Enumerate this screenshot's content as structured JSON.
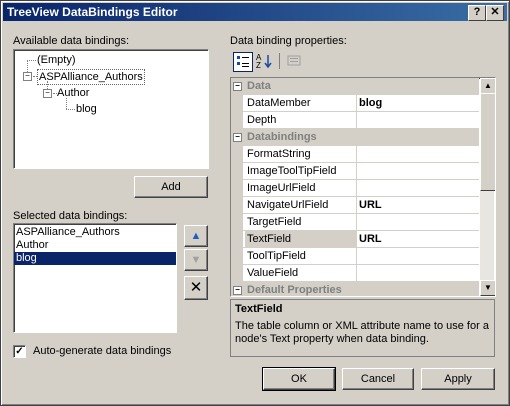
{
  "window": {
    "title": "TreeView DataBindings Editor",
    "help_glyph": "?",
    "close_glyph": "✕"
  },
  "available": {
    "label": "Available data bindings:",
    "items": [
      "(Empty)",
      "ASPAlliance_Authors",
      "Author",
      "blog"
    ],
    "expanded_glyph": "−"
  },
  "add_button": "Add",
  "selected": {
    "label": "Selected data bindings:",
    "items": [
      "ASPAlliance_Authors",
      "Author",
      "blog"
    ],
    "selected_index": 2
  },
  "move_up_glyph": "▲",
  "move_down_glyph": "▼",
  "delete_glyph": "✕",
  "properties": {
    "label": "Data binding properties:",
    "toolbar": {
      "categorized_icon": "categorized-icon",
      "alphabetical_icon": "alphabetical-icon",
      "pages_icon": "property-pages-icon"
    },
    "rows": [
      {
        "type": "cat",
        "name": "Data"
      },
      {
        "type": "prop",
        "name": "DataMember",
        "value": "blog"
      },
      {
        "type": "prop",
        "name": "Depth",
        "value": ""
      },
      {
        "type": "cat",
        "name": "Databindings"
      },
      {
        "type": "prop",
        "name": "FormatString",
        "value": ""
      },
      {
        "type": "prop",
        "name": "ImageToolTipField",
        "value": ""
      },
      {
        "type": "prop",
        "name": "ImageUrlField",
        "value": ""
      },
      {
        "type": "prop",
        "name": "NavigateUrlField",
        "value": "URL"
      },
      {
        "type": "prop",
        "name": "TargetField",
        "value": ""
      },
      {
        "type": "prop",
        "name": "TextField",
        "value": "URL",
        "active": true
      },
      {
        "type": "prop",
        "name": "ToolTipField",
        "value": ""
      },
      {
        "type": "prop",
        "name": "ValueField",
        "value": ""
      },
      {
        "type": "cat",
        "name": "Default Properties"
      }
    ],
    "category_glyph": "−",
    "description": {
      "title": "TextField",
      "text": "The table column or XML attribute name to use for a node's Text property when data binding."
    }
  },
  "autogen": {
    "label": "Auto-generate data bindings",
    "checked": true,
    "check_glyph": "✓"
  },
  "buttons": {
    "ok": "OK",
    "cancel": "Cancel",
    "apply": "Apply"
  },
  "scroll_glyphs": {
    "up": "▲",
    "down": "▼"
  }
}
